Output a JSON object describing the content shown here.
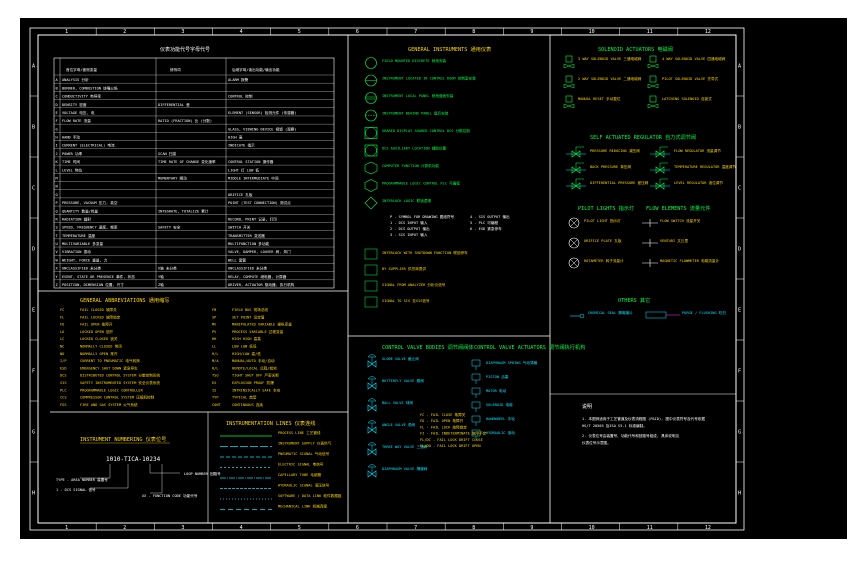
{
  "drawing": {
    "col_numbers": [
      "1",
      "2",
      "3",
      "4",
      "5",
      "6",
      "7",
      "8",
      "9",
      "10",
      "11",
      "12"
    ],
    "row_letters": [
      "A",
      "B",
      "C",
      "D",
      "E",
      "F",
      "G",
      "H"
    ],
    "table": {
      "title": "仪表功能代号字母代号",
      "col_headers": [
        "首位字母/被测变量",
        "修饰词",
        "后继字母/读出功能/输出功能"
      ],
      "rows": [
        {
          "l": "A",
          "c1": "ANALYSIS 分析",
          "c2": "",
          "c3": "ALARM 报警"
        },
        {
          "l": "B",
          "c1": "BURNER, COMBUSTION 烧嘴火焰",
          "c2": "",
          "c3": ""
        },
        {
          "l": "C",
          "c1": "CONDUCTIVITY 电导率",
          "c2": "",
          "c3": "CONTROL 控制"
        },
        {
          "l": "D",
          "c1": "DENSITY 密度",
          "c2": "DIFFERENTIAL 差",
          "c3": ""
        },
        {
          "l": "E",
          "c1": "VOLTAGE 电压, 电",
          "c2": "",
          "c3": "ELEMENT (SENSOR) 检测元件 (传感器)"
        },
        {
          "l": "F",
          "c1": "FLOW RATE 流量",
          "c2": "RATIO (FRACTION) 比 (分数)",
          "c3": ""
        },
        {
          "l": "G",
          "c1": "",
          "c2": "",
          "c3": "GLASS, VIEWING DEVICE 视镜 (观察)"
        },
        {
          "l": "H",
          "c1": "HAND 手动",
          "c2": "",
          "c3": "HIGH 高"
        },
        {
          "l": "I",
          "c1": "CURRENT (ELECTRICAL) 电流",
          "c2": "",
          "c3": "INDICATE 指示"
        },
        {
          "l": "J",
          "c1": "POWER 功率",
          "c2": "SCAN 扫描",
          "c3": ""
        },
        {
          "l": "K",
          "c1": "TIME 时间",
          "c2": "TIME RATE OF CHANGE 变化速率",
          "c3": "CONTROL STATION 操作器"
        },
        {
          "l": "L",
          "c1": "LEVEL 物位",
          "c2": "",
          "c3": "LIGHT 灯  LOW 低"
        },
        {
          "l": "M",
          "c1": "",
          "c2": "MOMENTARY 瞬动",
          "c3": "MIDDLE INTERMEDIATE 中间"
        },
        {
          "l": "N",
          "c1": "",
          "c2": "",
          "c3": ""
        },
        {
          "l": "O",
          "c1": "",
          "c2": "",
          "c3": "ORIFICE 孔板"
        },
        {
          "l": "P",
          "c1": "PRESSURE, VACUUM 压力, 真空",
          "c2": "",
          "c3": "POINT (TEST CONNECTION) 测试点"
        },
        {
          "l": "Q",
          "c1": "QUANTITY 数量/热量",
          "c2": "INTEGRATE, TOTALIZE 累计",
          "c3": ""
        },
        {
          "l": "R",
          "c1": "RADIATION 辐射",
          "c2": "",
          "c3": "RECORD, PRINT 记录, 打印"
        },
        {
          "l": "S",
          "c1": "SPEED, FREQUENCY 速度, 频率",
          "c2": "SAFETY 安全",
          "c3": "SWITCH 开关"
        },
        {
          "l": "T",
          "c1": "TEMPERATURE 温度",
          "c2": "",
          "c3": "TRANSMITTER 变送器"
        },
        {
          "l": "U",
          "c1": "MULTIVARIABLE 多变量",
          "c2": "",
          "c3": "MULTIFUNCTION 多功能"
        },
        {
          "l": "V",
          "c1": "VIBRATION 振动",
          "c2": "",
          "c3": "VALVE, DAMPER, LOUVER 阀, 风门"
        },
        {
          "l": "W",
          "c1": "WEIGHT, FORCE 重量, 力",
          "c2": "",
          "c3": "WELL 套管"
        },
        {
          "l": "X",
          "c1": "UNCLASSIFIED 未分类",
          "c2": "X轴 未分类",
          "c3": "UNCLASSIFIED 未分类"
        },
        {
          "l": "Y",
          "c1": "EVENT, STATE OR PRESENCE 事件, 状态",
          "c2": "Y轴",
          "c3": "RELAY, COMPUTE 继电器, 计算器"
        },
        {
          "l": "Z",
          "c1": "POSITION, DIMENSION 位置, 尺寸",
          "c2": "Z轴",
          "c3": "DRIVER, ACTUATOR 驱动器, 执行机构"
        }
      ]
    },
    "abbrev": {
      "title": "GENERAL ABBREVIATIONS 通用缩写",
      "left": [
        {
          "k": "FC",
          "v": "FAIL CLOSED 故障关"
        },
        {
          "k": "FL",
          "v": "FAIL LOCKED 故障锁定"
        },
        {
          "k": "FO",
          "v": "FAIL OPEN 故障开"
        },
        {
          "k": "LO",
          "v": "LOCKED OPEN 锁开"
        },
        {
          "k": "LC",
          "v": "LOCKED CLOSED 锁关"
        },
        {
          "k": "NC",
          "v": "NORMALLY CLOSED 常闭"
        },
        {
          "k": "NO",
          "v": "NORMALLY OPEN 常开"
        },
        {
          "k": "I/P",
          "v": "CURRENT TO PNEUMATIC 电气转换"
        },
        {
          "k": "ESD",
          "v": "EMERGENCY SHUT DOWN 紧急停车"
        },
        {
          "k": "DCS",
          "v": "DISTRIBUTED CONTROL SYSTEM 分散控制系统"
        },
        {
          "k": "SIS",
          "v": "SAFETY INSTRUMENTED SYSTEM 安全仪表系统"
        },
        {
          "k": "PLC",
          "v": "PROGRAMMABLE LOGIC CONTROLLER"
        },
        {
          "k": "CCS",
          "v": "COMPRESSOR CONTROL SYSTEM 压缩机控制"
        },
        {
          "k": "FGS",
          "v": "FIRE AND GAS SYSTEM 火气系统"
        }
      ],
      "right": [
        {
          "k": "FB",
          "v": "FIELD BUS 现场总线"
        },
        {
          "k": "SP",
          "v": "SET POINT 设定值"
        },
        {
          "k": "MV",
          "v": "MANIPULATED VARIABLE 操纵变量"
        },
        {
          "k": "PV",
          "v": "PROCESS VARIABLE 过程变量"
        },
        {
          "k": "HH",
          "v": "HIGH HIGH 高高"
        },
        {
          "k": "LL",
          "v": "LOW LOW 低低"
        },
        {
          "k": "H/L",
          "v": "HIGH/LOW 高/低"
        },
        {
          "k": "M/A",
          "v": "MANUAL/AUTO 手动/自动"
        },
        {
          "k": "R/L",
          "v": "REMOTE/LOCAL 远程/就地"
        },
        {
          "k": "TSO",
          "v": "TIGHT SHUT OFF 严密关断"
        },
        {
          "k": "EX",
          "v": "EXPLOSION PROOF 防爆"
        },
        {
          "k": "IS",
          "v": "INTRINSICALLY SAFE 本安"
        },
        {
          "k": "TYP",
          "v": "TYPICAL 典型"
        },
        {
          "k": "CONT",
          "v": "CONTINUOUS 连续"
        }
      ]
    },
    "numbering": {
      "title": "INSTRUMENT NUMBERING 仪表位号",
      "tag": "1010-TICA-10234",
      "labels": [
        "TYPE - AREA NUMBER 装置号",
        "LOOP NUMBER 回路号",
        "1 - DCS SIGNAL 信号",
        "XX - FUNCTION CODE 功能代号"
      ]
    },
    "lines": {
      "title": "INSTRUMENTATION LINES 仪表连线",
      "items": [
        "PROCESS LINE 工艺管线",
        "INSTRUMENT SUPPLY 仪表供气",
        "PNEUMATIC SIGNAL 气动信号",
        "ELECTRIC SIGNAL 电信号",
        "CAPILLARY TUBE 毛细管",
        "HYDRAULIC SIGNAL 液压信号",
        "SOFTWARE / DATA LINK 软件数据链",
        "MECHANICAL LINK 机械连接"
      ]
    },
    "gen_instr": {
      "title": "GENERAL INSTRUMENTS 通用仪表",
      "items": [
        "FIELD MOUNTED DISCRETE 就地安装",
        "INSTRUMENT LOCATED IN CONTROL ROOM 控制室安装",
        "INSTRUMENT LOCAL PANEL 就地盘面安装",
        "INSTRUMENT BEHIND PANEL 盘后安装",
        "SHARED DISPLAY SHARED CONTROL DCS 分散控制",
        "DCS AUXILIARY LOCATION 辅助位置",
        "COMPUTER FUNCTION 计算机功能",
        "PROGRAMMABLE LOGIC CONTROL PLC 可编程",
        "INTERLOCK LOGIC 联锁逻辑"
      ],
      "notes": [
        "P - SYMBOL FOR DRAWING 图纸符号",
        "1 - DCS INPUT 输入",
        "2 - DCS OUTPUT 输出",
        "3 - SIS INPUT 输入",
        "4 - SIS OUTPUT 输出",
        "5 - PLC 可编程",
        "6 - ESD 紧急停车"
      ],
      "bottom": [
        "INTERLOCK WITH SHUTDOWN FUNCTION 联锁停车",
        "BY SUPPLIER 供货商提供",
        "SIGNAL FROM ANALYZER 分析仪信号",
        "SIGNAL TO SIS 至SIS信号"
      ]
    },
    "cv_bodies": {
      "title": "CONTROL VALVE BODIES 调节阀阀体",
      "items": [
        "GLOBE VALVE 截止阀",
        "BUTTERFLY VALVE 蝶阀",
        "BALL VALVE 球阀",
        "ANGLE VALVE 角阀",
        "THREE WAY VALVE 三通阀",
        "DIAPHRAGM VALVE 隔膜阀"
      ]
    },
    "cv_act": {
      "title": "CONTROL VALVE ACTUATORS 调节阀执行机构",
      "items": [
        "DIAPHRAGM SPRING 气动薄膜",
        "PISTON 活塞",
        "MOTOR 电动",
        "SOLENOID 电磁",
        "HANDWHEEL 手轮",
        "HYDRAULIC 液动"
      ],
      "legend": [
        "FC - FAIL CLOSE 故障关",
        "FO - FAIL OPEN 故障开",
        "FL - FAIL LOCK 故障锁定",
        "FI - FAIL INDETERMINATE 故障不定",
        "FL/DC - FAIL LOCK DRIFT CLOSE",
        "FL/DO - FAIL LOCK DRIFT OPEN"
      ]
    },
    "solenoid": {
      "title": "SOLENOID ACTUATORS 电磁阀",
      "items": [
        "3 WAY SOLENOID VALVE 三通电磁阀",
        "2 WAY SOLENOID VALVE 二通电磁阀",
        "MANUAL RESET 手动复位",
        "4 WAY SOLENOID VALVE 四通电磁阀",
        "PILOT SOLENOID VALVE 先导式",
        "LATCHING SOLENOID 自锁式"
      ]
    },
    "regulator": {
      "title": "SELF ACTUATED REGULATOR 自力式调节阀",
      "items": [
        "PRESSURE REDUCING 减压阀",
        "BACK PRESSURE 背压阀",
        "DIFFERENTIAL PRESSURE 差压阀",
        "FLOW REGULATOR 流量调节",
        "TEMPERATURE REGULATOR 温度调节",
        "LEVEL REGULATOR 液位调节"
      ]
    },
    "flow_elem": {
      "title": "PILOT LIGHTS 指示灯",
      "title2": "FLOW ELEMENTS 流量元件",
      "items": [
        "PILOT LIGHT 指示灯",
        "FLOW SWITCH 流量开关",
        "ORIFICE PLATE 孔板",
        "VENTURI 文丘里",
        "ROTAMETER 转子流量计",
        "MAGNETIC FLOWMETER 电磁流量计"
      ]
    },
    "others": {
      "title": "OTHERS 其它",
      "items": [
        "CHEMICAL SEAL 隔离膜片",
        "PURGE / FLUSHING 吹扫"
      ]
    },
    "notes": {
      "title": "说明",
      "lines": [
        "1. 本图例适用于工艺管道及仪表流程图 (P&ID), 图中仪表符号及代号依据",
        "   HG/T 20505 及ISA S5.1 标准编制。",
        "2. 仪表位号由装置号、功能代号和回路号组成, 具体说明见",
        "   仪表位号示意图。"
      ]
    }
  }
}
